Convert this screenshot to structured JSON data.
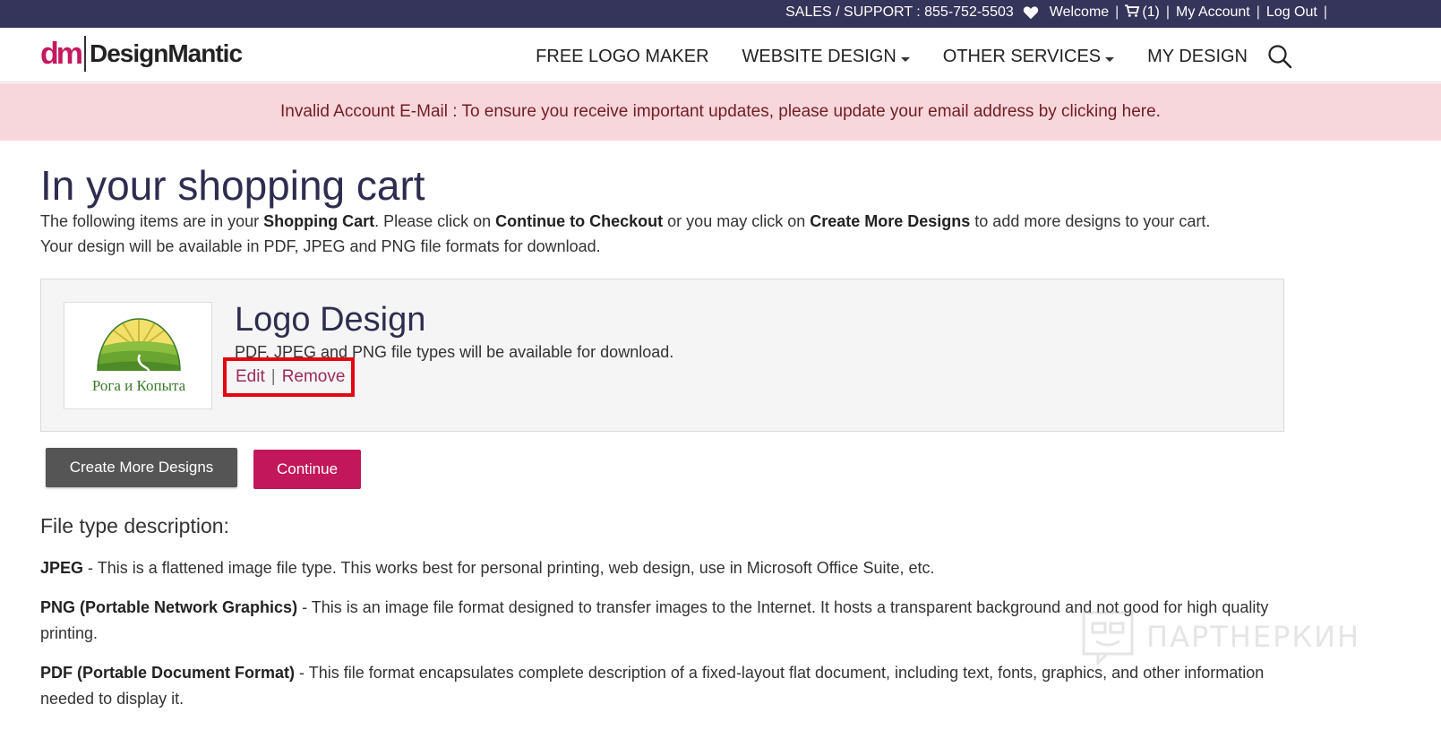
{
  "topbar": {
    "support": "SALES / SUPPORT : 855-752-5503",
    "welcome": "Welcome",
    "cart_count": "(1)",
    "my_account": "My Account",
    "logout": "Log Out",
    "icons": [
      "heart-icon",
      "cart-icon"
    ]
  },
  "header": {
    "logo_mark": "dm",
    "logo_name": "DesignMantic",
    "nav": [
      {
        "label": "FREE LOGO MAKER"
      },
      {
        "label": "WEBSITE DESIGN"
      },
      {
        "label": "OTHER SERVICES"
      },
      {
        "label": "MY DESIGN"
      }
    ],
    "search_icon": "search-icon"
  },
  "alert": {
    "text": "Invalid Account E-Mail : To ensure you receive important updates, please update your email address by clicking here."
  },
  "page": {
    "title": "In your shopping cart",
    "intro_1": "The following items are in your ",
    "intro_b1": "Shopping Cart",
    "intro_2": ". Please click on ",
    "intro_b2": "Continue to Checkout",
    "intro_3": " or you may click on ",
    "intro_b3": "Create More Designs",
    "intro_4": " to add more designs to your cart.",
    "intro_line2": "Your design will be available in PDF, JPEG and PNG file formats for download."
  },
  "cart_item": {
    "thumb_caption": "Рога и Копыта",
    "title": "Logo Design",
    "description": "PDF, JPEG and PNG file types will be available for download.",
    "edit": "Edit",
    "separator": "|",
    "remove": "Remove"
  },
  "buttons": {
    "create_more": "Create More Designs",
    "continue": "Continue"
  },
  "file_types": {
    "heading": "File type description:",
    "items": [
      {
        "name": "JPEG",
        "text": " - This is a flattened image file type. This works best for personal printing, web design, use in Microsoft Office Suite, etc."
      },
      {
        "name": "PNG (Portable Network Graphics)",
        "text": " - This is an image file format designed to transfer images to the Internet. It hosts a transparent background and not good for high quality printing."
      },
      {
        "name": "PDF (Portable Document Format)",
        "text": " - This file format encapsulates complete description of a fixed-layout flat document, including text, fonts, graphics, and other information needed to display it."
      }
    ]
  },
  "watermark": {
    "text": "ПАРТНЕРКИН"
  },
  "colors": {
    "topbar_bg": "#35345a",
    "alert_bg": "#f8d7dc",
    "alert_text": "#721c24",
    "brand_pink": "#c2185b",
    "highlight_border": "#e30613"
  }
}
